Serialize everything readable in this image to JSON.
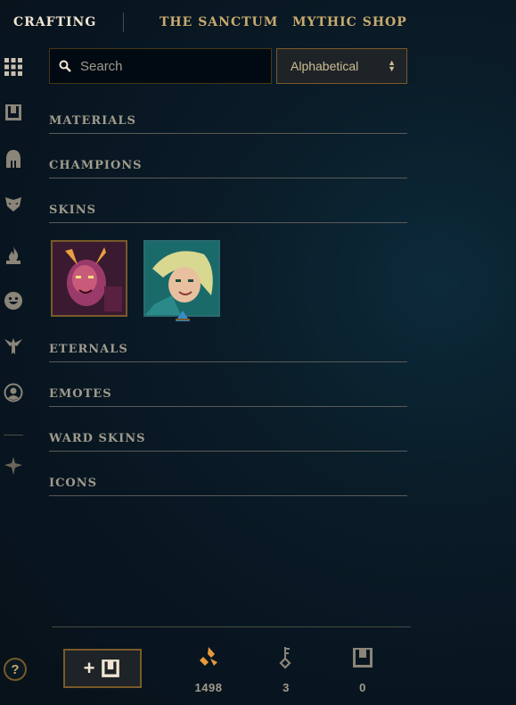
{
  "nav": {
    "tabs": [
      "CRAFTING",
      "THE SANCTUM",
      "MYTHIC SHOP"
    ],
    "active_tab": "CRAFTING"
  },
  "sidebar": {
    "icons": [
      "grid-icon",
      "chest-icon",
      "helmet-icon",
      "mask-icon",
      "flame-icon",
      "emote-face-icon",
      "ward-icon",
      "profile-icon",
      "eternals-icon"
    ]
  },
  "search": {
    "placeholder": "Search",
    "value": ""
  },
  "sort": {
    "selected": "Alphabetical"
  },
  "sections": [
    {
      "label": "MATERIALS"
    },
    {
      "label": "CHAMPIONS"
    },
    {
      "label": "SKINS"
    },
    {
      "label": "ETERNALS"
    },
    {
      "label": "EMOTES"
    },
    {
      "label": "WARD SKINS"
    },
    {
      "label": "ICONS"
    }
  ],
  "skins": {
    "count": 2
  },
  "footer": {
    "add_chest_label": "+",
    "currencies": [
      {
        "name": "orange-essence-icon",
        "amount": "1498",
        "color": "#e89a3c"
      },
      {
        "name": "key-icon",
        "amount": "3",
        "color": "#a09b8c"
      },
      {
        "name": "chest-icon",
        "amount": "0",
        "color": "#a09b8c"
      }
    ],
    "help_label": "?"
  },
  "colors": {
    "gold": "#c8aa6e",
    "gold_dark": "#785a28",
    "text": "#a09b8c",
    "orange": "#e89a3c"
  }
}
